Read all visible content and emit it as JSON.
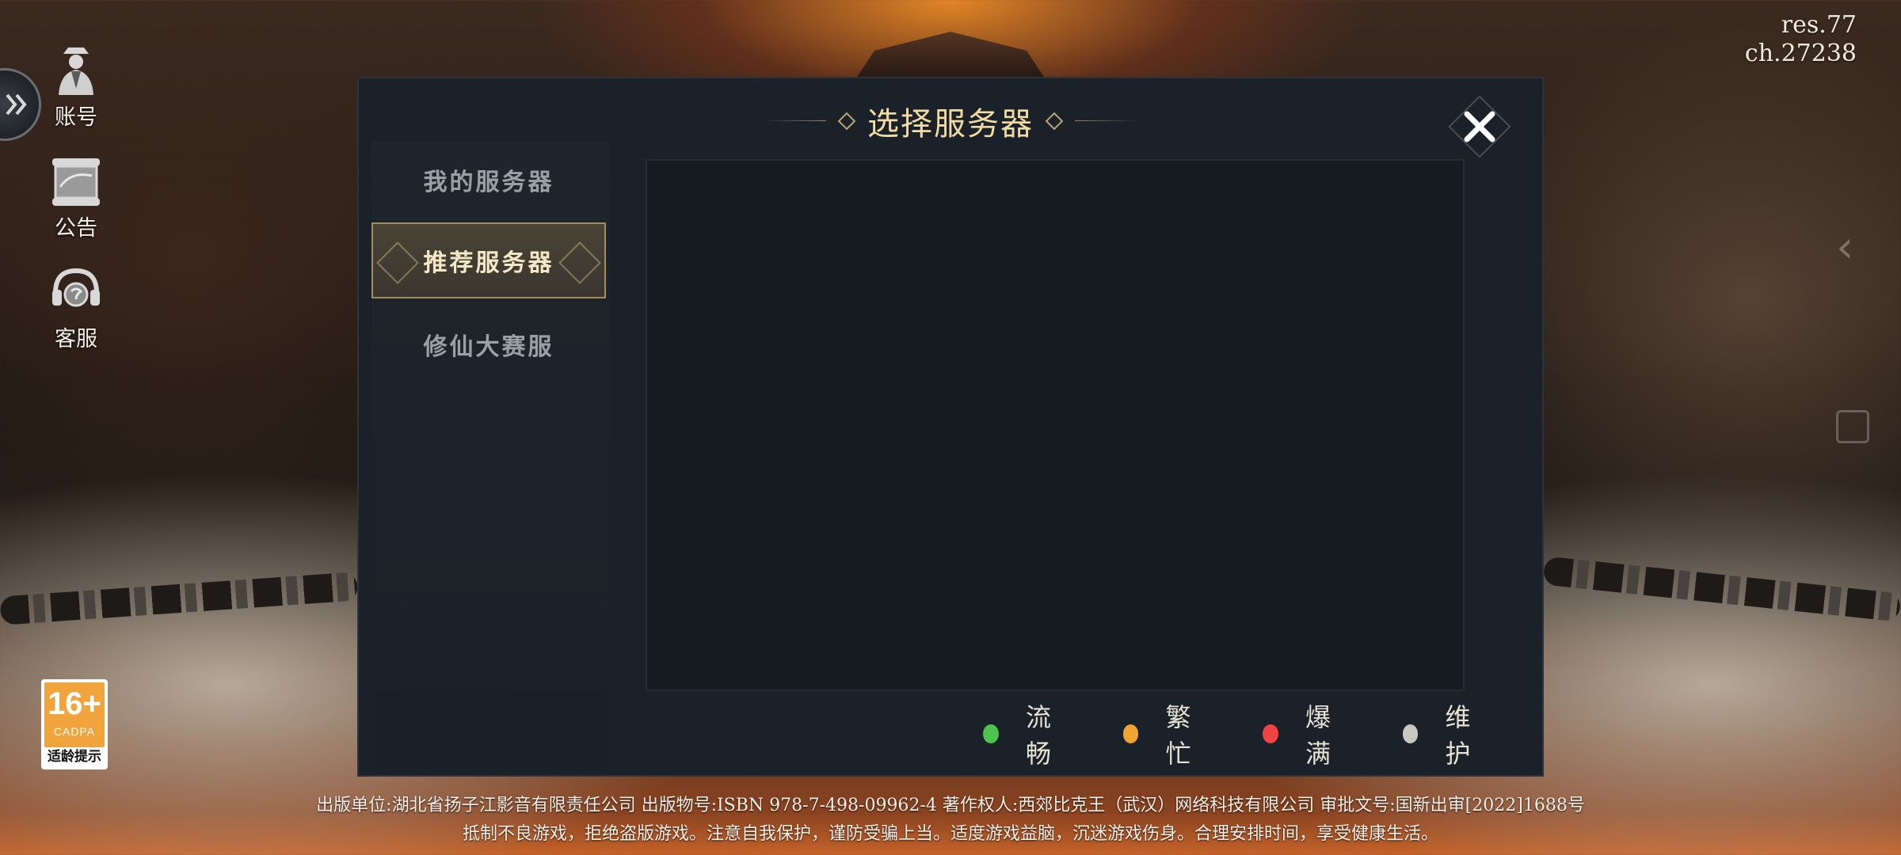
{
  "version": {
    "res": "res.77",
    "ch": "ch.27238"
  },
  "side_menu": {
    "account_label": "账号",
    "notice_label": "公告",
    "service_label": "客服"
  },
  "age_rating": {
    "age": "16+",
    "org": "CADPA",
    "tip": "适龄提示"
  },
  "dialog": {
    "title": "选择服务器",
    "tabs": [
      {
        "label": "我的服务器",
        "active": false
      },
      {
        "label": "推荐服务器",
        "active": true
      },
      {
        "label": "修仙大赛服",
        "active": false
      }
    ],
    "legend": [
      {
        "label": "流畅",
        "color": "#4fc24f"
      },
      {
        "label": "繁忙",
        "color": "#f0a531"
      },
      {
        "label": "爆满",
        "color": "#ee4444"
      },
      {
        "label": "维护",
        "color": "#c8c8c0"
      }
    ]
  },
  "legal": {
    "line1": "出版单位:湖北省扬子江影音有限责任公司 出版物号:ISBN 978-7-498-09962-4 著作权人:西郊比克王（武汉）网络科技有限公司  审批文号:国新出审[2022]1688号",
    "line2": "抵制不良游戏，拒绝盗版游戏。注意自我保护，谨防受骗上当。适度游戏益脑，沉迷游戏伤身。合理安排时间，享受健康生活。"
  }
}
